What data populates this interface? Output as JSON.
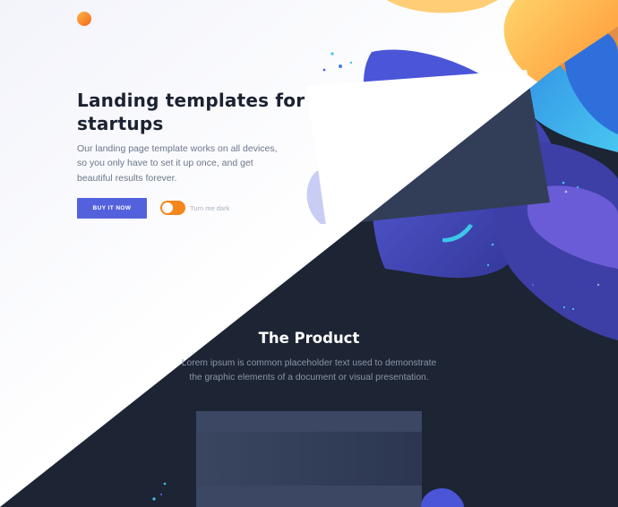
{
  "hero": {
    "title": "Landing templates for startups",
    "description": "Our landing page template works on all devices, so you only have to set it up once, and get beautiful results forever.",
    "buy_button_label": "BUY IT NOW",
    "toggle_label": "Turn me dark",
    "toggle_on": true
  },
  "product": {
    "title": "The Product",
    "description": "Lorem ipsum is common placeholder text used to demonstrate the graphic elements of a document or visual presentation."
  },
  "colors": {
    "accent_button": "#5461dc",
    "toggle": "#f4861c",
    "dark_background": "#1d2433",
    "heading_text": "#1b2231"
  }
}
